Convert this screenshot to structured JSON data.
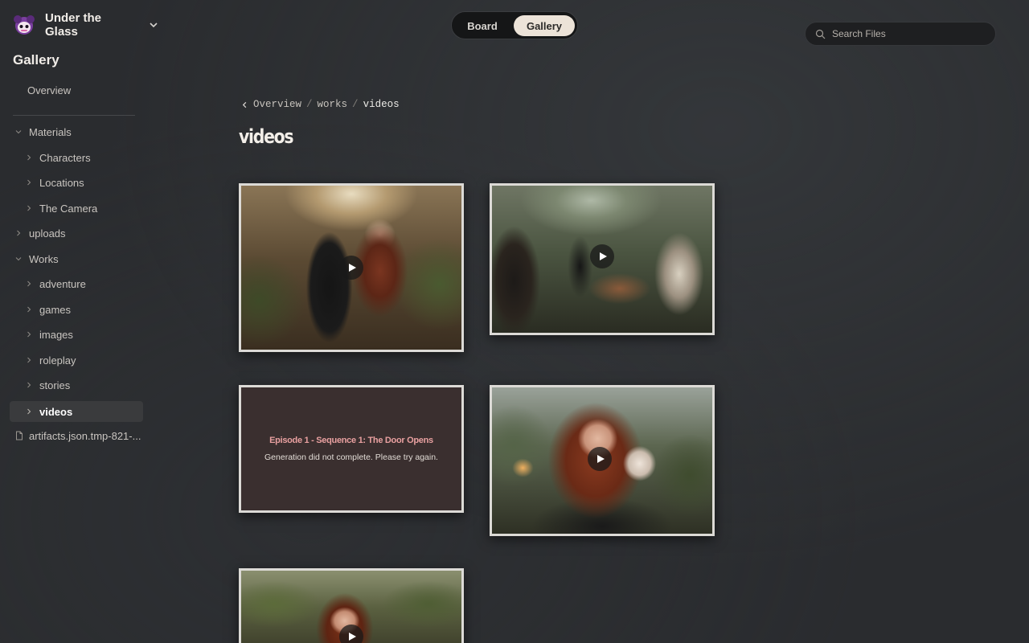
{
  "app": {
    "title": "Under the Glass"
  },
  "sidebar": {
    "heading": "Gallery",
    "overview": "Overview",
    "items": [
      {
        "label": "Materials",
        "expanded": true,
        "level": 0
      },
      {
        "label": "Characters",
        "level": 1
      },
      {
        "label": "Locations",
        "level": 1
      },
      {
        "label": "The Camera",
        "level": 1
      },
      {
        "label": "uploads",
        "level": 0
      },
      {
        "label": "Works",
        "expanded": true,
        "level": 0
      },
      {
        "label": "adventure",
        "level": 1
      },
      {
        "label": "games",
        "level": 1
      },
      {
        "label": "images",
        "level": 1
      },
      {
        "label": "roleplay",
        "level": 1
      },
      {
        "label": "stories",
        "level": 1
      },
      {
        "label": "videos",
        "level": 1,
        "selected": true
      },
      {
        "label": "artifacts.json.tmp-821-...",
        "level": 0,
        "icon": "file-icon"
      }
    ]
  },
  "view_toggle": {
    "board": "Board",
    "gallery": "Gallery",
    "active": "Gallery"
  },
  "search": {
    "placeholder": "Search Files",
    "value": ""
  },
  "breadcrumb": {
    "root": "Overview",
    "parent": "works",
    "current": "videos"
  },
  "page": {
    "title": "videos"
  },
  "cards": [
    {
      "type": "video",
      "icon": "play-icon"
    },
    {
      "type": "video",
      "icon": "play-icon"
    },
    {
      "type": "error",
      "title": "Episode 1 - Sequence 1: The Door Opens",
      "message": "Generation did not complete. Please try again."
    },
    {
      "type": "video",
      "icon": "play-icon"
    },
    {
      "type": "video",
      "icon": "play-icon"
    }
  ],
  "colors": {
    "accent_toggle": "#ece3d8",
    "error_title": "#e8a0a0",
    "background": "#2a2c2f"
  }
}
